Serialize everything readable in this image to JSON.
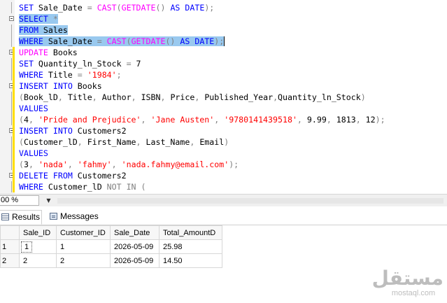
{
  "editor": {
    "lines": [
      [
        {
          "t": "SET ",
          "c": "kw"
        },
        {
          "t": "Sale_Date "
        },
        {
          "t": "= ",
          "c": "gray"
        },
        {
          "t": "CAST",
          "c": "fn"
        },
        {
          "t": "(",
          "c": "gray"
        },
        {
          "t": "GETDATE",
          "c": "fn"
        },
        {
          "t": "() ",
          "c": "gray"
        },
        {
          "t": "AS ",
          "c": "kw"
        },
        {
          "t": "DATE",
          "c": "kw"
        },
        {
          "t": ");",
          "c": "gray"
        }
      ],
      [
        {
          "t": "SELECT ",
          "c": "kw"
        },
        {
          "t": "*",
          "c": "gray"
        }
      ],
      [
        {
          "t": "FROM ",
          "c": "kw"
        },
        {
          "t": "Sales"
        }
      ],
      [
        {
          "t": "WHERE ",
          "c": "kw"
        },
        {
          "t": "Sale_Date "
        },
        {
          "t": "= ",
          "c": "gray"
        },
        {
          "t": "CAST",
          "c": "fn"
        },
        {
          "t": "(",
          "c": "gray"
        },
        {
          "t": "GETDATE",
          "c": "fn"
        },
        {
          "t": "() ",
          "c": "gray"
        },
        {
          "t": "AS ",
          "c": "kw"
        },
        {
          "t": "DATE",
          "c": "kw"
        },
        {
          "t": ");",
          "c": "gray"
        }
      ],
      [
        {
          "t": "UPDATE ",
          "c": "fn"
        },
        {
          "t": "Books"
        }
      ],
      [
        {
          "t": "SET ",
          "c": "kw"
        },
        {
          "t": "Quantity_ln_Stock "
        },
        {
          "t": "= ",
          "c": "gray"
        },
        {
          "t": "7"
        }
      ],
      [
        {
          "t": "WHERE ",
          "c": "kw"
        },
        {
          "t": "Title "
        },
        {
          "t": "= ",
          "c": "gray"
        },
        {
          "t": "'1984'",
          "c": "str"
        },
        {
          "t": ";",
          "c": "gray"
        }
      ],
      [
        {
          "t": "INSERT ",
          "c": "kw"
        },
        {
          "t": "INTO ",
          "c": "kw"
        },
        {
          "t": "Books"
        }
      ],
      [
        {
          "t": "(",
          "c": "gray"
        },
        {
          "t": "Book_lD"
        },
        {
          "t": ", ",
          "c": "gray"
        },
        {
          "t": "Title"
        },
        {
          "t": ", ",
          "c": "gray"
        },
        {
          "t": "Author"
        },
        {
          "t": ", ",
          "c": "gray"
        },
        {
          "t": "ISBN"
        },
        {
          "t": ", ",
          "c": "gray"
        },
        {
          "t": "Price"
        },
        {
          "t": ", ",
          "c": "gray"
        },
        {
          "t": "Published_Year"
        },
        {
          "t": ",",
          "c": "gray"
        },
        {
          "t": "Quantity_ln_Stock"
        },
        {
          "t": ")",
          "c": "gray"
        }
      ],
      [
        {
          "t": "VALUES",
          "c": "kw"
        }
      ],
      [
        {
          "t": "(",
          "c": "gray"
        },
        {
          "t": "4"
        },
        {
          "t": ", ",
          "c": "gray"
        },
        {
          "t": "'Pride and Prejudice'",
          "c": "str"
        },
        {
          "t": ", ",
          "c": "gray"
        },
        {
          "t": "'Jane Austen'",
          "c": "str"
        },
        {
          "t": ", ",
          "c": "gray"
        },
        {
          "t": "'9780141439518'",
          "c": "str"
        },
        {
          "t": ", ",
          "c": "gray"
        },
        {
          "t": "9.99"
        },
        {
          "t": ", ",
          "c": "gray"
        },
        {
          "t": "1813"
        },
        {
          "t": ", ",
          "c": "gray"
        },
        {
          "t": "12"
        },
        {
          "t": ");",
          "c": "gray"
        }
      ],
      [
        {
          "t": "INSERT ",
          "c": "kw"
        },
        {
          "t": "INTO ",
          "c": "kw"
        },
        {
          "t": "Customers2"
        }
      ],
      [
        {
          "t": "(",
          "c": "gray"
        },
        {
          "t": "Customer_lD"
        },
        {
          "t": ", ",
          "c": "gray"
        },
        {
          "t": "First_Name"
        },
        {
          "t": ", ",
          "c": "gray"
        },
        {
          "t": "Last_Name"
        },
        {
          "t": ", ",
          "c": "gray"
        },
        {
          "t": "Email"
        },
        {
          "t": ")",
          "c": "gray"
        }
      ],
      [
        {
          "t": "VALUES",
          "c": "kw"
        }
      ],
      [
        {
          "t": "(",
          "c": "gray"
        },
        {
          "t": "3"
        },
        {
          "t": ", ",
          "c": "gray"
        },
        {
          "t": "'nada'",
          "c": "str"
        },
        {
          "t": ", ",
          "c": "gray"
        },
        {
          "t": "'fahmy'",
          "c": "str"
        },
        {
          "t": ", ",
          "c": "gray"
        },
        {
          "t": "'nada.fahmy@email.com'",
          "c": "str"
        },
        {
          "t": ");",
          "c": "gray"
        }
      ],
      [
        {
          "t": "DELETE ",
          "c": "kw"
        },
        {
          "t": "FROM ",
          "c": "kw"
        },
        {
          "t": "Customers2"
        }
      ],
      [
        {
          "t": "WHERE ",
          "c": "kw"
        },
        {
          "t": "Customer_lD "
        },
        {
          "t": "NOT ",
          "c": "gray"
        },
        {
          "t": "IN ",
          "c": "gray"
        },
        {
          "t": "(",
          "c": "gray"
        }
      ]
    ],
    "selected_lines": [
      1,
      2,
      3
    ],
    "fold_lines": [
      1,
      4,
      7,
      11,
      15
    ]
  },
  "zoom": {
    "value": "00 %",
    "arrow": "▼"
  },
  "tabs": [
    {
      "label": "Results",
      "icon": "grid-icon",
      "active": true
    },
    {
      "label": "Messages",
      "icon": "messages-icon",
      "active": false
    }
  ],
  "grid": {
    "columns": [
      "Sale_ID",
      "Customer_ID",
      "Sale_Date",
      "Total_AmountD"
    ],
    "rows": [
      {
        "num": "1",
        "cells": [
          "1",
          "1",
          "2026-05-09",
          "25.98"
        ]
      },
      {
        "num": "2",
        "cells": [
          "2",
          "2",
          "2026-05-09",
          "14.50"
        ]
      }
    ]
  },
  "watermark": {
    "arabic": "مستقل",
    "latin": "mostaql.com"
  },
  "colors": {
    "keyword": "#0000ff",
    "function": "#ff00ff",
    "string": "#ff0000",
    "operator": "#808080",
    "selection": "#99c9ef"
  }
}
